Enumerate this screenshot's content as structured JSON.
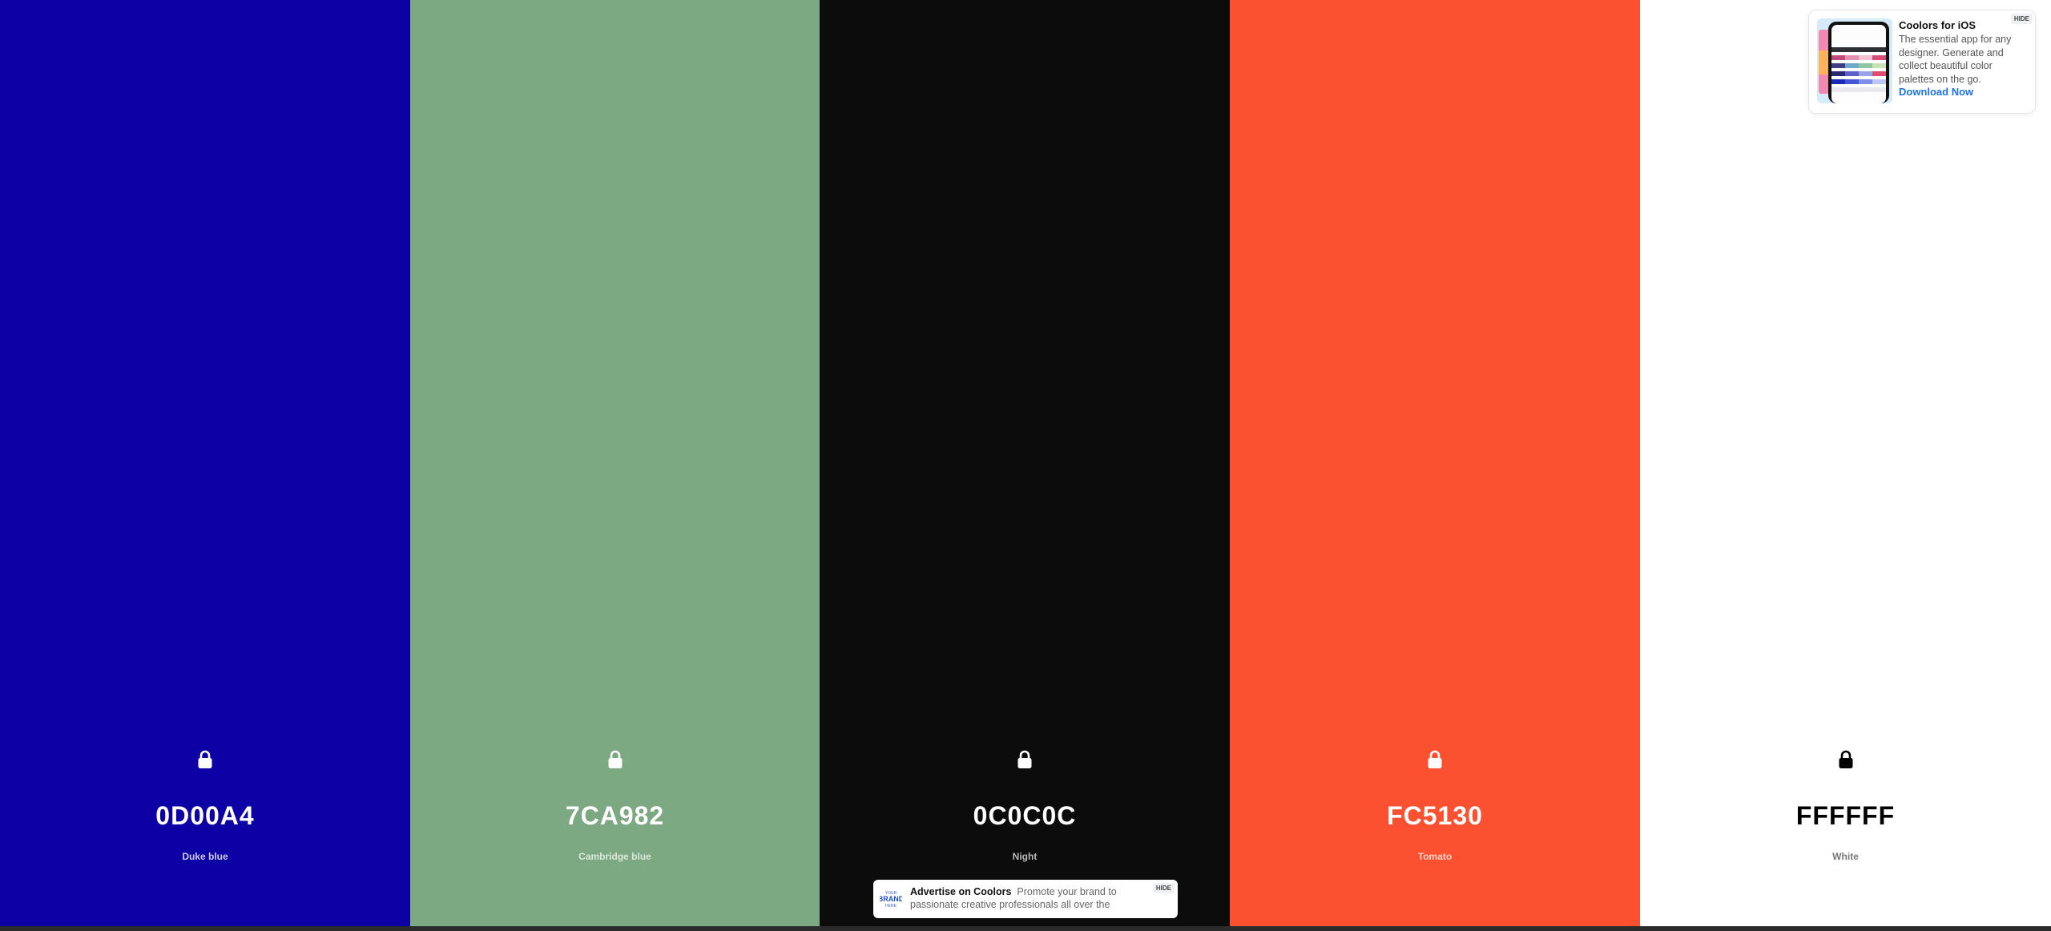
{
  "palette": {
    "colors": [
      {
        "hex": "0D00A4",
        "name": "Duke blue",
        "bg": "#0D00A4",
        "text_color": "#ffffff",
        "name_color": "#cfcdf0"
      },
      {
        "hex": "7CA982",
        "name": "Cambridge blue",
        "bg": "#7CA982",
        "text_color": "#ffffff",
        "name_color": "#dbe8dc"
      },
      {
        "hex": "0C0C0C",
        "name": "Night",
        "bg": "#0C0C0C",
        "text_color": "#ffffff",
        "name_color": "#b8b8b8"
      },
      {
        "hex": "FC5130",
        "name": "Tomato",
        "bg": "#FC5130",
        "text_color": "#ffffff",
        "name_color": "#fed1c7"
      },
      {
        "hex": "FFFFFF",
        "name": "White",
        "bg": "#FFFFFF",
        "text_color": "#000000",
        "name_color": "#777777"
      }
    ]
  },
  "ios_ad": {
    "title": "Coolors for iOS",
    "description": "The essential app for any designer. Generate and collect beautiful color palettes on the go.",
    "link": "Download Now",
    "hide_label": "HIDE"
  },
  "bottom_ad": {
    "title": "Advertise on Coolors",
    "text": "Promote your brand to passionate creative professionals all over the",
    "hide_label": "HIDE",
    "logo_icon": "your-brand-here-logo"
  },
  "icons": {
    "lock": "lock-icon"
  }
}
